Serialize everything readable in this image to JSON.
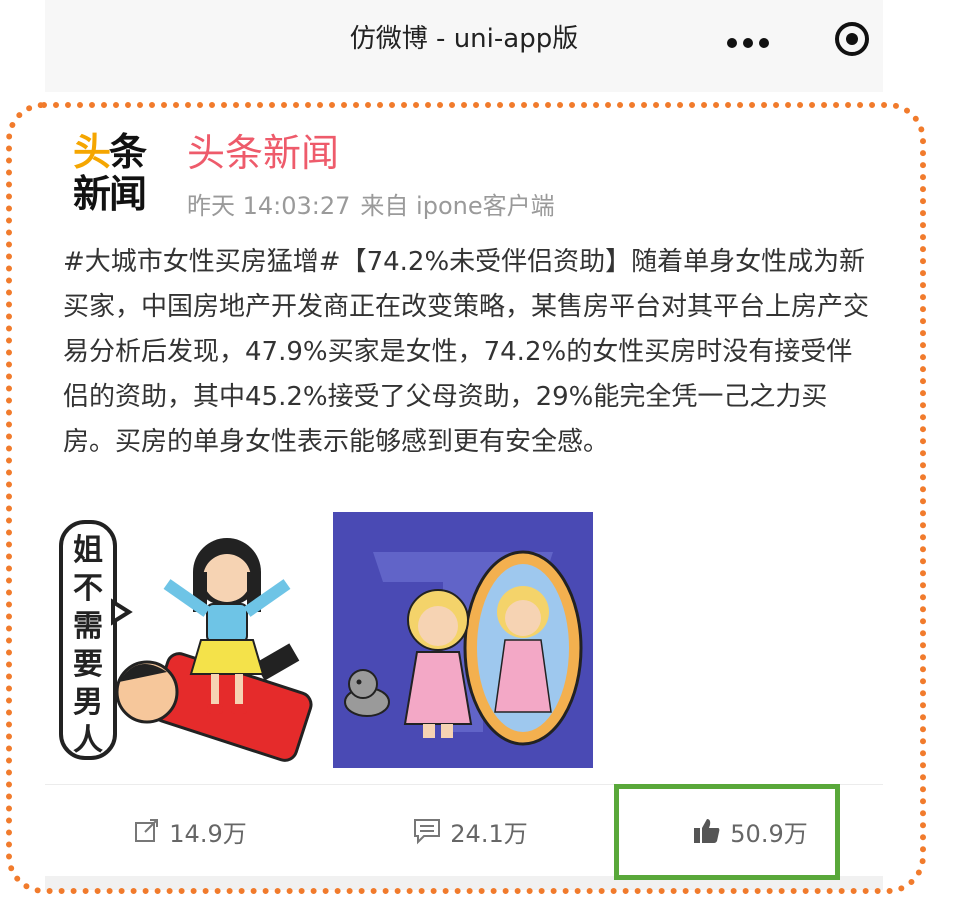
{
  "nav": {
    "title": "仿微博 - uni-app版",
    "icons": [
      "more-icon",
      "record-icon"
    ]
  },
  "post": {
    "avatar": {
      "line1_part1": "头",
      "line1_part2": "条",
      "line2": "新闻"
    },
    "username": "头条新闻",
    "time": "昨天 14:03:27",
    "source": "来自 ipone客户端",
    "content": "#大城市女性买房猛增#【74.2%未受伴侣资助】随着单身女性成为新买家，中国房地产开发商正在改变策略，某售房平台对其平台上房产交易分析后发现，47.9%买家是女性，74.2%的女性买房时没有接受伴侣的资助，其中45.2%接受了父母资助，29%能完全凭一己之力买房。买房的单身女性表示能够感到更有安全感。",
    "image1_text": [
      "姐",
      "不",
      "需",
      "要",
      "男",
      "人"
    ]
  },
  "actions": {
    "share": {
      "icon": "share-icon",
      "count": "14.9万"
    },
    "comment": {
      "icon": "comment-icon",
      "count": "24.1万"
    },
    "like": {
      "icon": "thumb-up-icon",
      "count": "50.9万"
    }
  },
  "colors": {
    "username": "#ee5b6b",
    "frame": "#f17b2c",
    "highlight": "#59a83a"
  }
}
